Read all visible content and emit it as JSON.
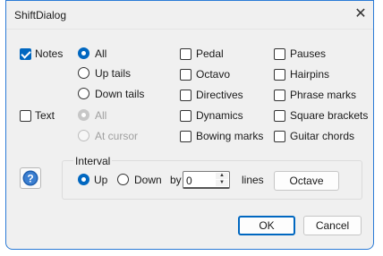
{
  "window": {
    "title": "ShiftDialog",
    "close_glyph": "✕"
  },
  "notes": {
    "label": "Notes",
    "checked": true,
    "radios": [
      {
        "label": "All",
        "checked": true
      },
      {
        "label": "Up tails",
        "checked": false
      },
      {
        "label": "Down tails",
        "checked": false
      }
    ]
  },
  "text": {
    "label": "Text",
    "checked": false,
    "radios": [
      {
        "label": "All",
        "checked": true,
        "disabled": true
      },
      {
        "label": "At cursor",
        "checked": false,
        "disabled": true
      }
    ]
  },
  "column2": [
    {
      "label": "Pedal"
    },
    {
      "label": "Octavo"
    },
    {
      "label": "Directives"
    },
    {
      "label": "Dynamics"
    },
    {
      "label": "Bowing marks"
    }
  ],
  "column3": [
    {
      "label": "Pauses"
    },
    {
      "label": "Hairpins"
    },
    {
      "label": "Phrase marks"
    },
    {
      "label": "Square brackets"
    },
    {
      "label": "Guitar chords"
    }
  ],
  "interval": {
    "label": "Interval",
    "up_label": "Up",
    "down_label": "Down",
    "selected": "Up",
    "by_label": "by",
    "value": "0",
    "lines_label": "lines",
    "octave_button": "Octave"
  },
  "buttons": {
    "ok": "OK",
    "cancel": "Cancel"
  },
  "help": {
    "icon": "help-icon"
  },
  "colors": {
    "accent": "#0067c0",
    "border": "#2b7bd6"
  }
}
